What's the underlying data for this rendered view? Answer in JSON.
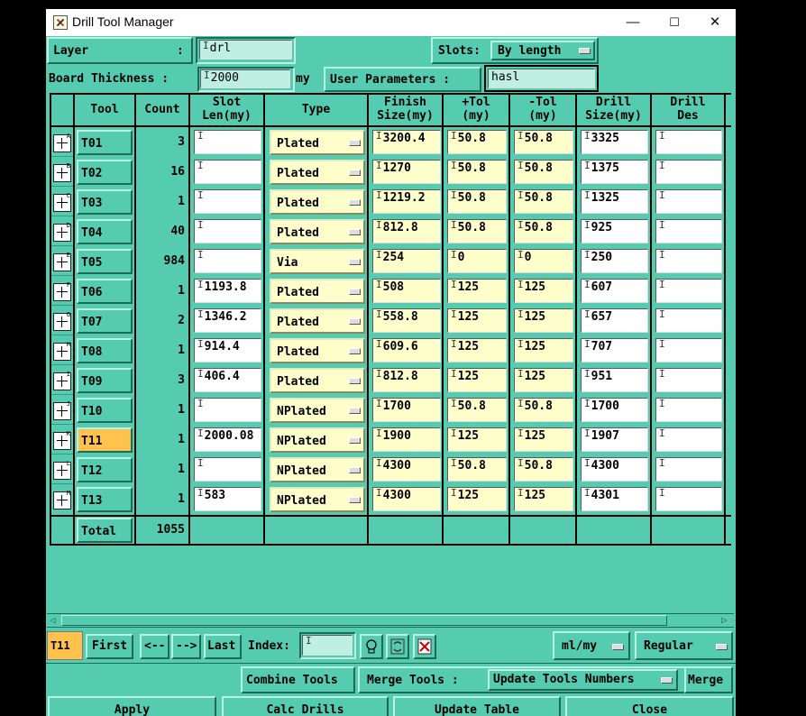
{
  "window": {
    "title": "Drill Tool Manager",
    "minimize": "—",
    "maximize": "☐",
    "close": "✕"
  },
  "top": {
    "layer_label": "Layer",
    "layer_colon": ":",
    "layer_value": "drl",
    "slots_label": "Slots:",
    "slots_value": "By length",
    "board_thickness_label": "Board Thickness :",
    "board_thickness_value": "2000",
    "board_thickness_unit": "my",
    "user_params_label": "User Parameters :",
    "user_params_value": "hasl"
  },
  "headers": {
    "tool": "Tool",
    "count": "Count",
    "slot_len": [
      "Slot",
      "Len(my)"
    ],
    "type": "Type",
    "finish": [
      "Finish",
      "Size(my)"
    ],
    "ptol": [
      "+Tol",
      "(my)"
    ],
    "mtol": [
      "-Tol",
      "(my)"
    ],
    "drill_size": [
      "Drill",
      "Size(my)"
    ],
    "drill_des": [
      "Drill",
      "Des"
    ]
  },
  "rows": [
    {
      "tool": "T01",
      "count": "3",
      "slot": "",
      "type": "Plated",
      "finish": "3200.4",
      "ptol": "50.8",
      "mtol": "50.8",
      "drill": "3325",
      "des": ""
    },
    {
      "tool": "T02",
      "count": "16",
      "slot": "",
      "type": "Plated",
      "finish": "1270",
      "ptol": "50.8",
      "mtol": "50.8",
      "drill": "1375",
      "des": ""
    },
    {
      "tool": "T03",
      "count": "1",
      "slot": "",
      "type": "Plated",
      "finish": "1219.2",
      "ptol": "50.8",
      "mtol": "50.8",
      "drill": "1325",
      "des": ""
    },
    {
      "tool": "T04",
      "count": "40",
      "slot": "",
      "type": "Plated",
      "finish": "812.8",
      "ptol": "50.8",
      "mtol": "50.8",
      "drill": "925",
      "des": ""
    },
    {
      "tool": "T05",
      "count": "984",
      "slot": "",
      "type": "Via",
      "finish": "254",
      "ptol": "0",
      "mtol": "0",
      "drill": "250",
      "des": ""
    },
    {
      "tool": "T06",
      "count": "1",
      "slot": "1193.8",
      "type": "Plated",
      "finish": "508",
      "ptol": "125",
      "mtol": "125",
      "drill": "607",
      "des": ""
    },
    {
      "tool": "T07",
      "count": "2",
      "slot": "1346.2",
      "type": "Plated",
      "finish": "558.8",
      "ptol": "125",
      "mtol": "125",
      "drill": "657",
      "des": ""
    },
    {
      "tool": "T08",
      "count": "1",
      "slot": "914.4",
      "type": "Plated",
      "finish": "609.6",
      "ptol": "125",
      "mtol": "125",
      "drill": "707",
      "des": ""
    },
    {
      "tool": "T09",
      "count": "3",
      "slot": "406.4",
      "type": "Plated",
      "finish": "812.8",
      "ptol": "125",
      "mtol": "125",
      "drill": "951",
      "des": ""
    },
    {
      "tool": "T10",
      "count": "1",
      "slot": "",
      "type": "NPlated",
      "finish": "1700",
      "ptol": "50.8",
      "mtol": "50.8",
      "drill": "1700",
      "des": ""
    },
    {
      "tool": "T11",
      "count": "1",
      "slot": "2000.08",
      "type": "NPlated",
      "finish": "1900",
      "ptol": "125",
      "mtol": "125",
      "drill": "1907",
      "des": "",
      "selected": true
    },
    {
      "tool": "T12",
      "count": "1",
      "slot": "",
      "type": "NPlated",
      "finish": "4300",
      "ptol": "50.8",
      "mtol": "50.8",
      "drill": "4300",
      "des": ""
    },
    {
      "tool": "T13",
      "count": "1",
      "slot": "583",
      "type": "NPlated",
      "finish": "4300",
      "ptol": "125",
      "mtol": "125",
      "drill": "4301",
      "des": ""
    }
  ],
  "total": {
    "label": "Total",
    "value": "1055"
  },
  "nav": {
    "current_tool": "T11",
    "first": "First",
    "prev": "<--",
    "next": "-->",
    "last": "Last",
    "index_label": "Index:",
    "index_value": "",
    "units_value": "ml/my",
    "mode_value": "Regular"
  },
  "tools_bar": {
    "combine": "Combine Tools",
    "merge_label": "Merge Tools :",
    "merge_value": "Update Tools Numbers",
    "merge": "Merge"
  },
  "actions": {
    "apply": "Apply",
    "calc": "Calc Drills",
    "update": "Update Table",
    "close": "Close"
  }
}
